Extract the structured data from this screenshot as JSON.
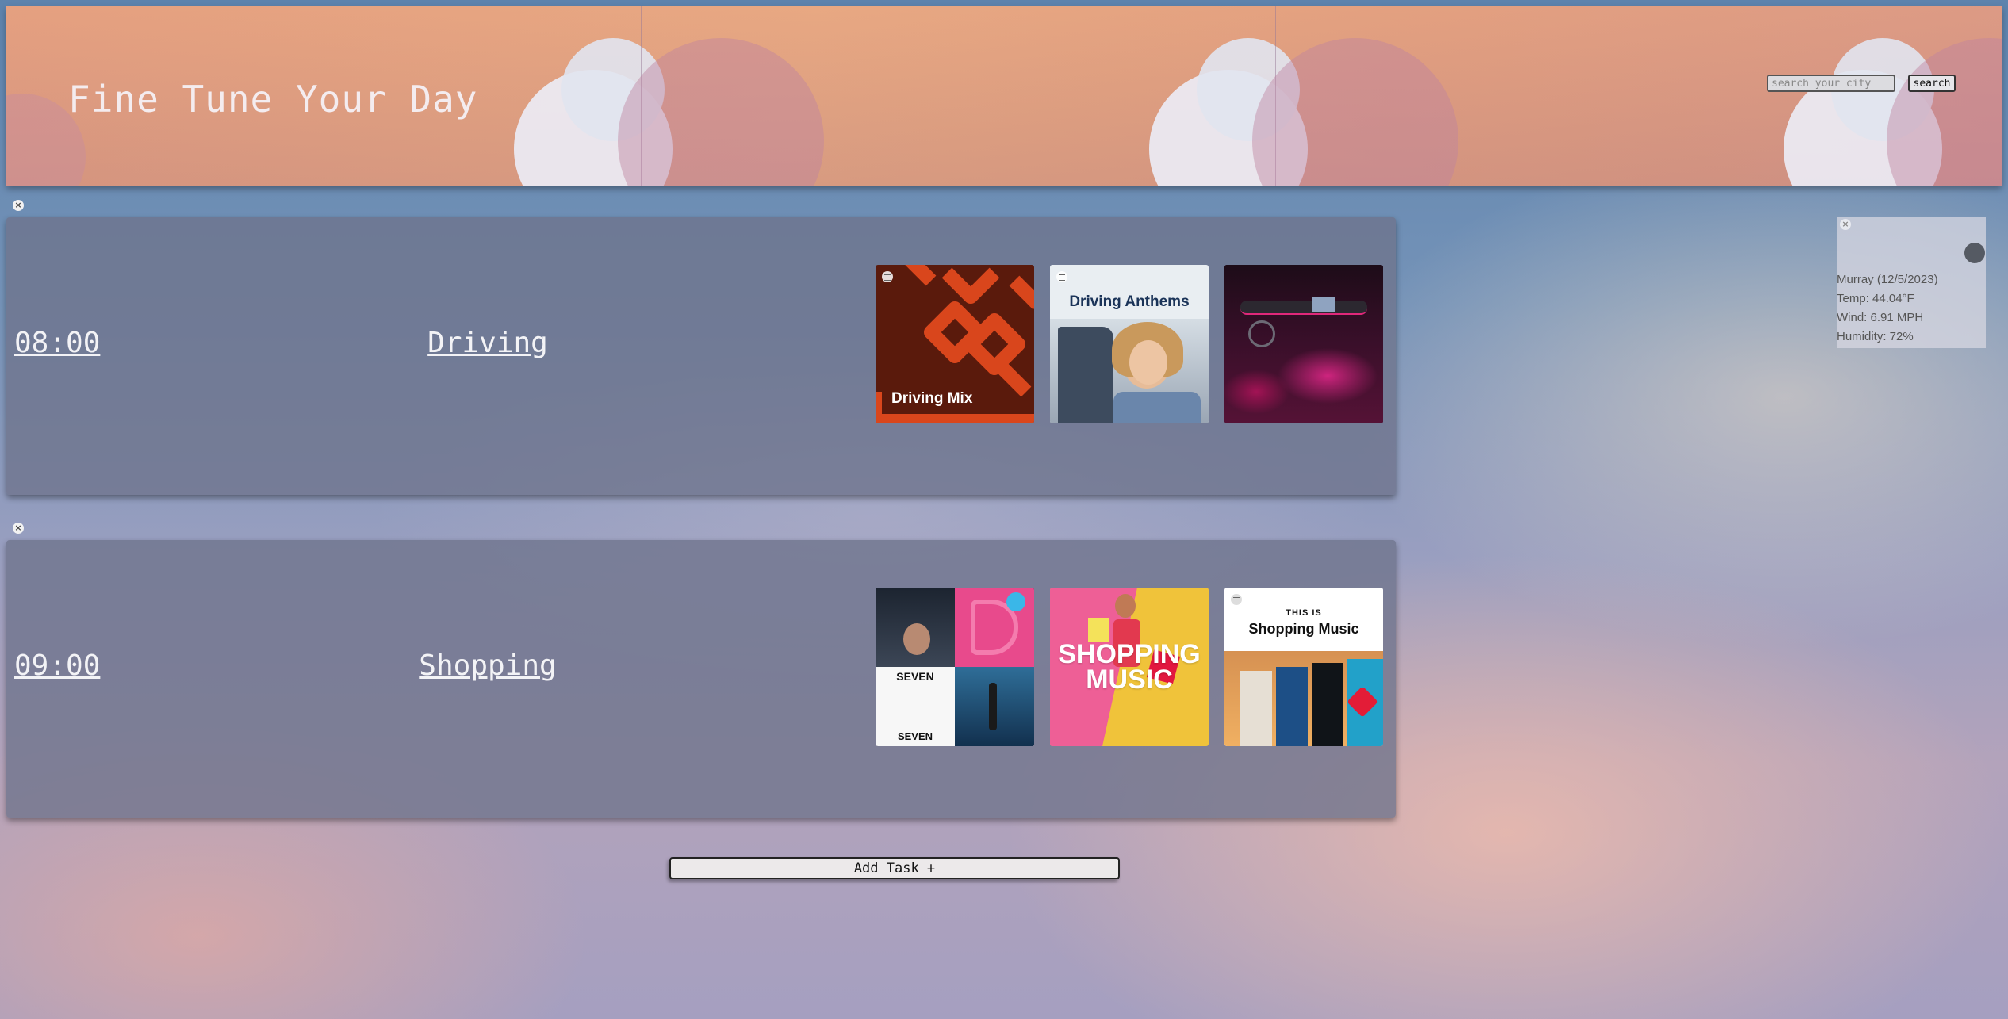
{
  "header": {
    "title": "Fine Tune Your Day",
    "search_placeholder": "search your city",
    "search_label": "search"
  },
  "tasks": [
    {
      "time": "08:00",
      "name": "Driving",
      "playlists": [
        {
          "title": "Driving Mix",
          "style": "spotify-mix",
          "color": "#5a1a0c"
        },
        {
          "title": "Driving Anthems",
          "style": "photo-title",
          "color": "#e9eef2"
        },
        {
          "title": "",
          "style": "car-interior",
          "color": "#2a0a1e"
        }
      ]
    },
    {
      "time": "09:00",
      "name": "Shopping",
      "playlists": [
        {
          "title": "SEVEN",
          "style": "collage",
          "color": "#e84a8c"
        },
        {
          "title": "SHOPPING MUSIC",
          "style": "shopping",
          "color": "#f0c33a"
        },
        {
          "title": "Shopping Music",
          "kicker": "THIS IS",
          "style": "this-is",
          "color": "#ffffff"
        }
      ]
    }
  ],
  "add_task_label": "Add Task +",
  "weather": {
    "city_date": "Murray (12/5/2023)",
    "temp": "Temp: 44.04°F",
    "wind": "Wind: 6.91 MPH",
    "humidity": "Humidity: 72%",
    "icon": "cloud-icon"
  },
  "close_glyph": "×"
}
